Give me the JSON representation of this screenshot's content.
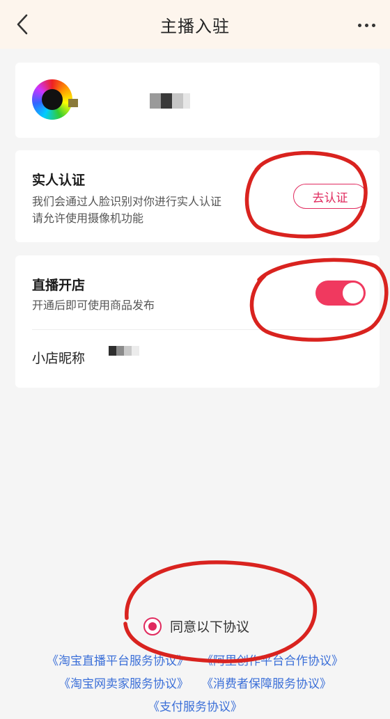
{
  "header": {
    "title": "主播入驻"
  },
  "verification": {
    "title": "实人认证",
    "description_line1": "我们会通过人脸识别对你进行实人认证",
    "description_line2": "请允许使用摄像机功能",
    "button_label": "去认证"
  },
  "live_shop": {
    "title": "直播开店",
    "description": "开通后即可使用商品发布",
    "toggle_on": true,
    "nickname_label": "小店昵称"
  },
  "agreement": {
    "checked": true,
    "label": "同意以下协议",
    "links": [
      "《淘宝直播平台服务协议》",
      "《阿里创作平台合作协议》",
      "《淘宝网卖家服务协议》",
      "《消费者保障服务协议》",
      "《支付服务协议》"
    ]
  },
  "colors": {
    "accent": "#e02a5e",
    "toggle": "#f0395f",
    "link": "#3b6fd8",
    "annotation": "#d9231f",
    "header_bg": "#fdf5ed"
  },
  "icons": [
    "back-arrow-icon",
    "more-dots-icon"
  ]
}
